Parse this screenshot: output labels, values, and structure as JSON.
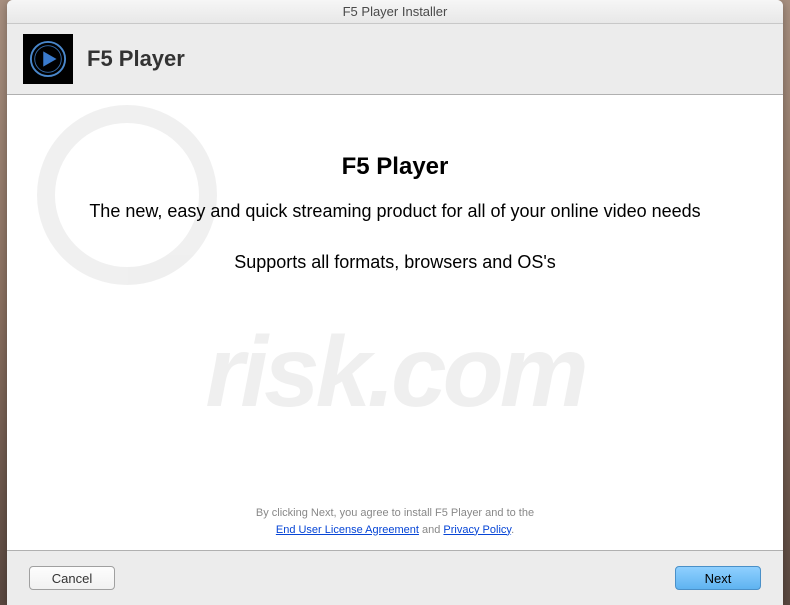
{
  "window": {
    "title": "F5 Player Installer"
  },
  "header": {
    "app_name": "F5 Player"
  },
  "content": {
    "title": "F5 Player",
    "subtitle": "The new, easy and quick streaming product for all of your online video needs",
    "support": "Supports all formats, browsers and OS's"
  },
  "legal": {
    "prefix": "By clicking Next, you agree to install F5 Player and to the",
    "eula_label": "End User License Agreement",
    "and": " and ",
    "privacy_label": "Privacy Policy",
    "suffix": "."
  },
  "footer": {
    "cancel_label": "Cancel",
    "next_label": "Next"
  },
  "watermark": {
    "text": "risk.com"
  }
}
